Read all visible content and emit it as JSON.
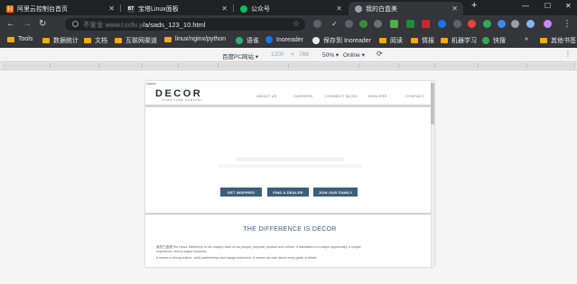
{
  "tabs": [
    {
      "title": "阿里云控制台首页",
      "favicon": "[-]",
      "favicon_color": "#ff6a00",
      "active": false
    },
    {
      "title": "宝塔Linux面板",
      "favicon": "BT",
      "favicon_color": "#3c3c3c",
      "active": false
    },
    {
      "title": "公众号",
      "favicon": "",
      "favicon_color": "#07c160",
      "active": false
    },
    {
      "title": "我的白盒美",
      "favicon": "",
      "favicon_color": "#9aa0a6",
      "active": true
    }
  ],
  "window_controls": {
    "new_tab": "+",
    "minimize": "—",
    "maximize": "☐",
    "close": "✕"
  },
  "address_bar": {
    "url_prefix": "不安全",
    "url_host": "www.l.ccfu.y",
    "url_path": "/a/sads_123_10.html"
  },
  "bookmarks": [
    {
      "label": "Tools",
      "type": "folder"
    },
    {
      "label": "数据统计",
      "type": "folder"
    },
    {
      "label": "文档",
      "type": "folder"
    },
    {
      "label": "互联网渠道",
      "type": "folder"
    },
    {
      "label": "linux/nginx/python",
      "type": "folder"
    },
    {
      "label": "语雀",
      "type": "site",
      "color": "#31b16f"
    },
    {
      "label": "Inoreader",
      "type": "site",
      "color": "#1875f0"
    },
    {
      "label": "保存到 Inoreader",
      "type": "site",
      "color": "#e8eaed"
    },
    {
      "label": "阅读",
      "type": "folder"
    },
    {
      "label": "情报",
      "type": "folder"
    },
    {
      "label": "机器学习",
      "type": "folder"
    },
    {
      "label": "快搜",
      "type": "site",
      "color": "#34a853"
    },
    {
      "label": "»",
      "type": "more"
    },
    {
      "label": "其他书签",
      "type": "folder"
    }
  ],
  "device_toolbar": {
    "device": "百度PC网站",
    "width": "1200",
    "times": "×",
    "height": "768",
    "zoom": "50%",
    "network": "Online"
  },
  "site": {
    "breadcrumb": "Home",
    "logo": "DECOR",
    "logo_tagline": "FURNITURE COMPANY",
    "nav": [
      "ABOUT US",
      "CAREERS",
      "CONNECT BLOG",
      "DEALERS",
      "CONTACT"
    ],
    "buttons": [
      "GET INSPIRED",
      "FIND A DEALER",
      "JOIN OUR FAMILY"
    ],
    "section_title": "THE DIFFERENCE IS DECOR",
    "paragraphs": [
      "我的白盒美The Decor Difference is the unique result of our people, purpose, product and culture. It translates to a unique opportunity, a unique",
      "experience, and a unique business.",
      "It means a strong culture, solid partnerships and happy customers. It means we care about every grain of detail."
    ]
  }
}
